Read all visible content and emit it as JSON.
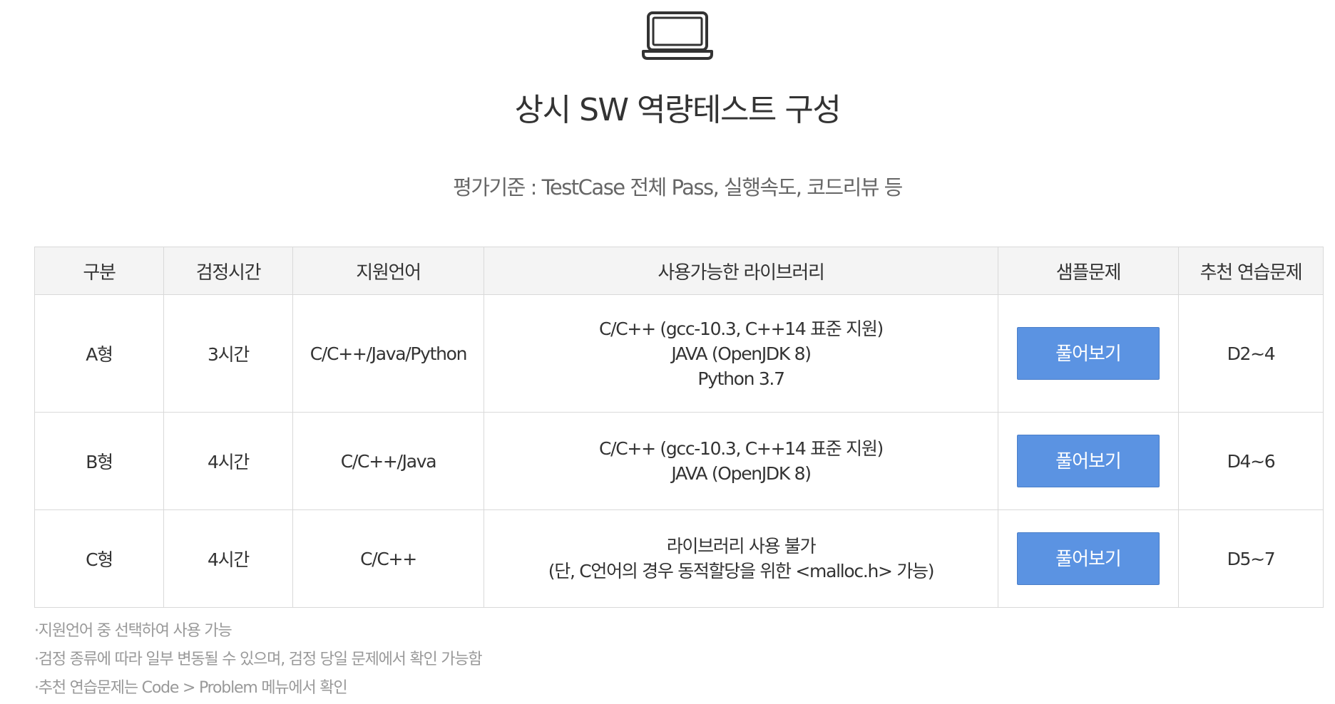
{
  "header": {
    "icon": "laptop-icon",
    "title": "상시 SW 역량테스트 구성",
    "subtitle": "평가기준 : TestCase 전체 Pass, 실행속도, 코드리뷰 등"
  },
  "table": {
    "headers": [
      "구분",
      "검정시간",
      "지원언어",
      "사용가능한 라이브러리",
      "샘플문제",
      "추천 연습문제"
    ],
    "rows": [
      {
        "type": "A형",
        "time": "3시간",
        "languages": "C/C++/Java/Python",
        "libraries": [
          "C/C++ (gcc-10.3, C++14 표준 지원)",
          "JAVA (OpenJDK 8)",
          "Python 3.7"
        ],
        "sample_button": "풀어보기",
        "practice": "D2~4"
      },
      {
        "type": "B형",
        "time": "4시간",
        "languages": "C/C++/Java",
        "libraries": [
          "C/C++ (gcc-10.3, C++14 표준 지원)",
          "JAVA (OpenJDK 8)"
        ],
        "sample_button": "풀어보기",
        "practice": "D4~6"
      },
      {
        "type": "C형",
        "time": "4시간",
        "languages": "C/C++",
        "libraries": [
          "라이브러리 사용 불가",
          "(단, C언어의 경우 동적할당을 위한 <malloc.h> 가능)"
        ],
        "sample_button": "풀어보기",
        "practice": "D5~7"
      }
    ]
  },
  "notes": [
    "·지원언어 중 선택하여 사용 가능",
    "·검정 종류에 따라 일부 변동될 수 있으며, 검정 당일 문제에서 확인 가능함",
    "·추천 연습문제는 Code > Problem 메뉴에서 확인"
  ],
  "colors": {
    "button_bg": "#5b93e2",
    "header_bg": "#f4f4f4",
    "border": "#d9d9d9",
    "note_text": "#999999"
  }
}
